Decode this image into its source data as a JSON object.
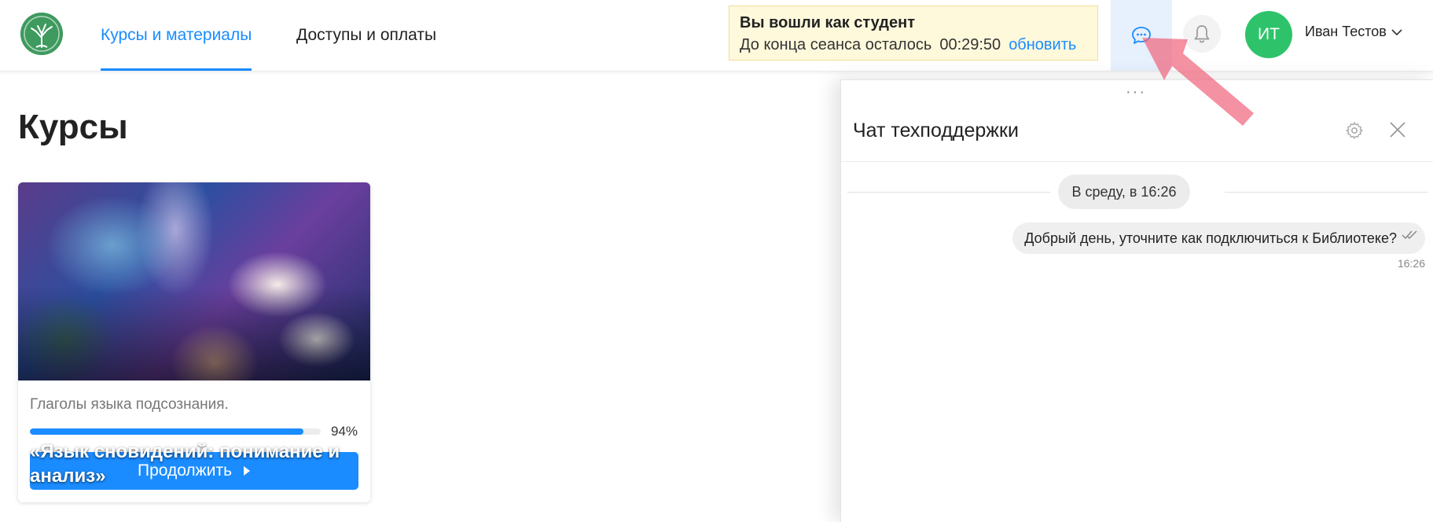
{
  "header": {
    "logo_icon": "tree-logo-icon",
    "nav": [
      {
        "label": "Курсы и материалы",
        "active": true
      },
      {
        "label": "Доступы и оплаты",
        "active": false
      }
    ],
    "session": {
      "title": "Вы вошли как студент",
      "remaining_label": "До конца сеанса осталось",
      "timer": "00:29:50",
      "refresh_label": "обновить"
    },
    "chat_icon": "chat-bubble-icon",
    "bell_icon": "bell-icon",
    "user": {
      "initials": "ИТ",
      "name": "Иван Тестов",
      "avatar_color": "#2ec36a"
    }
  },
  "main": {
    "title": "Курсы",
    "course": {
      "title": "«Язык сновидений: понимание и анализ»",
      "lesson": "Глаголы языка подсознания.",
      "progress": 0.94,
      "progress_label": "94%",
      "button_label": "Продолжить"
    }
  },
  "chat": {
    "title": "Чат техподдержки",
    "drag_label": "···",
    "date_separator": "В среду, в 16:26",
    "messages": [
      {
        "text": "Добрый день, уточните как подключиться к Библиотеке?",
        "time": "16:26",
        "status": "read"
      }
    ]
  },
  "colors": {
    "accent": "#1a8cff",
    "avatar": "#2ec36a",
    "session_bg": "#fff9dc",
    "annotation_arrow": "#f0637a"
  }
}
